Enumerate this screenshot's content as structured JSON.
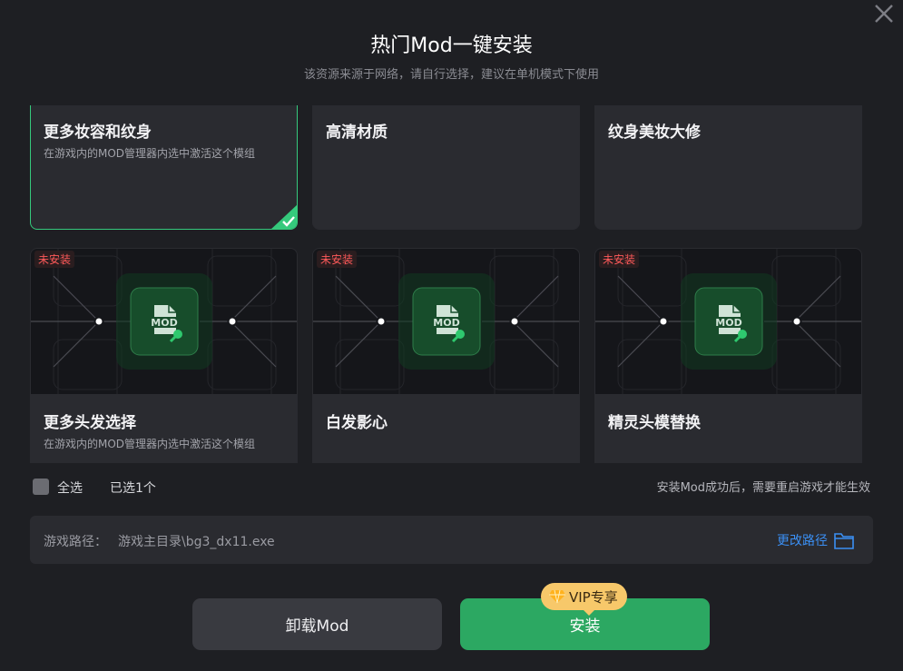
{
  "dialog": {
    "title": "热门Mod一键安装",
    "subtitle": "该资源来源于网络，请自行选择，建议在单机模式下使用"
  },
  "mods": [
    {
      "name": "更多妆容和纹身",
      "desc": "在游戏内的MOD管理器内选中激活这个模组",
      "badge": "",
      "selected": true
    },
    {
      "name": "高清材质",
      "desc": "",
      "badge": "",
      "selected": false
    },
    {
      "name": "纹身美妆大修",
      "desc": "",
      "badge": "",
      "selected": false
    },
    {
      "name": "更多头发选择",
      "desc": "在游戏内的MOD管理器内选中激活这个模组",
      "badge": "未安装",
      "selected": false
    },
    {
      "name": "白发影心",
      "desc": "",
      "badge": "未安装",
      "selected": false
    },
    {
      "name": "精灵头模替换",
      "desc": "",
      "badge": "未安装",
      "selected": false
    }
  ],
  "mod_icon_text": "MOD",
  "footer": {
    "select_all": "全选",
    "selected_count": "已选1个",
    "restart_note": "安装Mod成功后，需要重启游戏才能生效"
  },
  "path": {
    "label": "游戏路径：",
    "value": "游戏主目录\\bg3_dx11.exe",
    "change_label": "更改路径"
  },
  "buttons": {
    "uninstall": "卸载Mod",
    "install": "安装",
    "vip_badge": "VIP专享"
  },
  "colors": {
    "accent_green": "#2ca862",
    "selected_border": "#35c97c",
    "link_blue": "#3b8ff3",
    "vip_gold": "#f7c86a",
    "not_installed_red": "#ff5a5a"
  }
}
